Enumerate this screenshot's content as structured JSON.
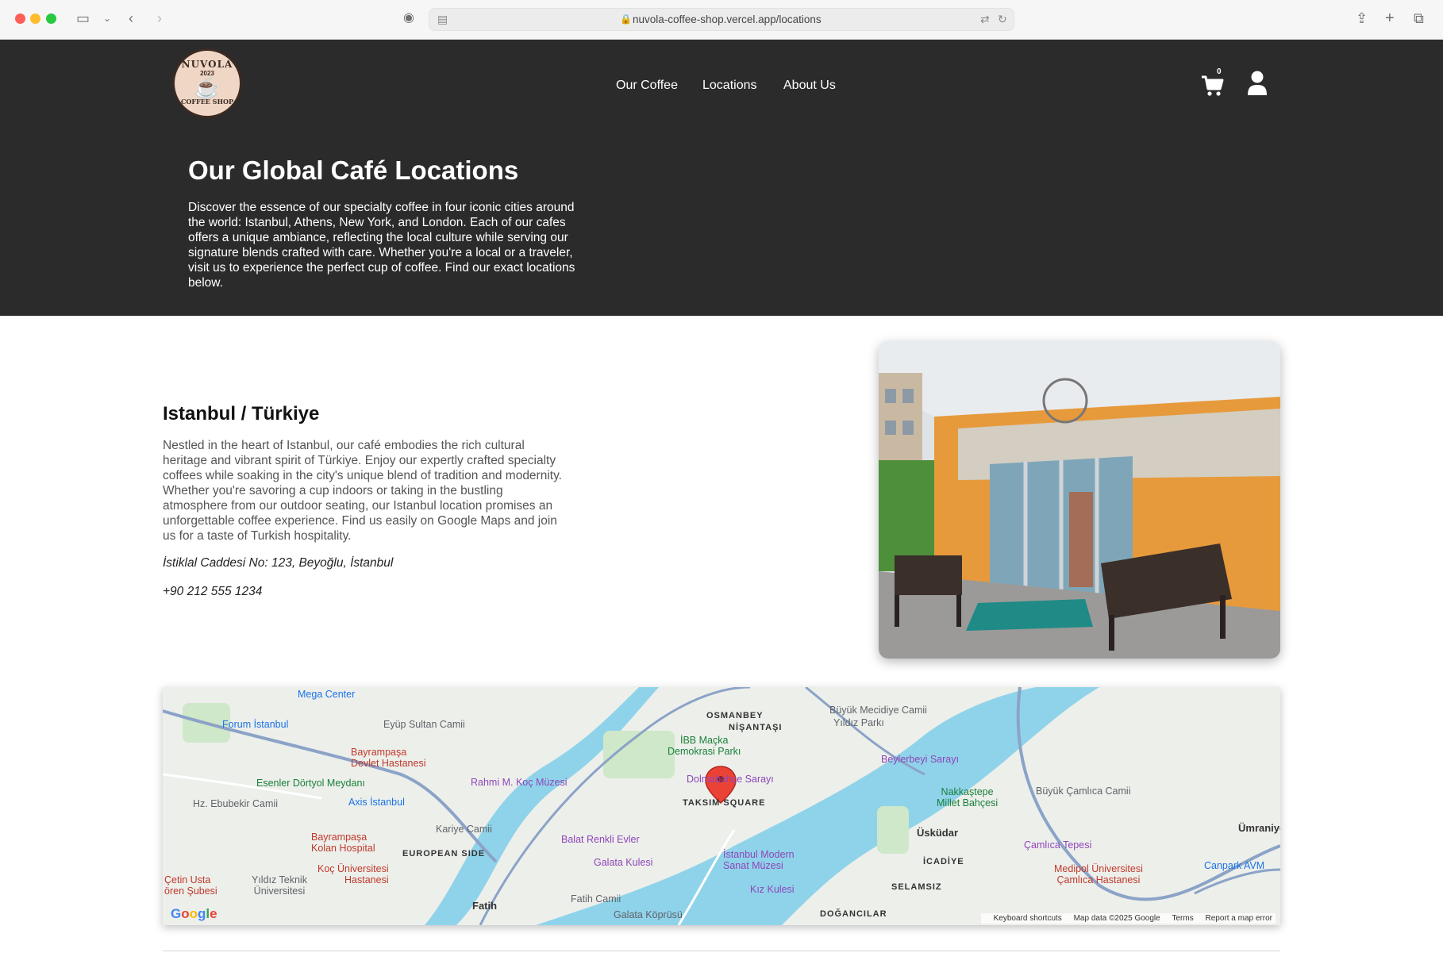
{
  "browser": {
    "url": "nuvola-coffee-shop.vercel.app/locations"
  },
  "header": {
    "logo": {
      "top": "NUVOLA",
      "year": "2023",
      "bottom": "COFFEE SHOP"
    },
    "nav": [
      "Our Coffee",
      "Locations",
      "About Us"
    ],
    "cart_count": "0",
    "icons": [
      "cart-icon",
      "user-icon"
    ]
  },
  "hero": {
    "title": "Our Global Café Locations",
    "text": "Discover the essence of our specialty coffee in four iconic cities around the world: Istanbul, Athens, New York, and London. Each of our cafes offers a unique ambiance, reflecting the local culture while serving our signature blends crafted with care. Whether you're a local or a traveler, visit us to experience the perfect cup of coffee. Find our exact locations below."
  },
  "location": {
    "title": "Istanbul / Türkiye",
    "description": "Nestled in the heart of Istanbul, our café embodies the rich cultural heritage and vibrant spirit of Türkiye. Enjoy our expertly crafted specialty coffees while soaking in the city's unique blend of tradition and modernity. Whether you're savoring a cup indoors or taking in the bustling atmosphere from our outdoor seating, our Istanbul location promises an unforgettable coffee experience. Find us easily on Google Maps and join us for a taste of Turkish hospitality.",
    "address": "İstiklal Caddesi No: 123, Beyoğlu, İstanbul",
    "phone": "+90 212 555 1234"
  },
  "map": {
    "labels": {
      "mega_center": "Mega Center",
      "forum": "Forum İstanbul",
      "eyup": "Eyüp Sultan Camii",
      "bayrampasa_devlet": "Bayrampaşa\nDevlet Hastanesi",
      "esenler": "Esenler Dörtyol Meydanı",
      "rahmi": "Rahmi M. Koç Müzesi",
      "axis": "Axis İstanbul",
      "ebubekir": "Hz. Ebubekir Camii",
      "bayrampasa_kolan": "Bayrampaşa\nKolan Hospital",
      "kariye": "Kariye Camii",
      "balat": "Balat Renkli Evler",
      "koc_uni": "Koç Üniversitesi\nHastanesi",
      "european": "EUROPEAN SIDE",
      "yildiz": "Yıldız Teknik\nÜniversitesi",
      "fatih": "Fatih",
      "fatih_camii": "Fatih Camii",
      "galata_kulesi": "Galata Kulesi",
      "galata_koprusu": "Galata Köprüsü",
      "osmanbey": "OSMANBEY",
      "nisantasi": "NİŞANTAŞI",
      "ibb": "İBB Maçka\nDemokrasi Parkı",
      "dolmabahce": "Dolmabahçe Sarayı",
      "taksim": "TAKSIM SQUARE",
      "istanbul_modern": "İstanbul Modern\nSanat Müzesi",
      "kiz_kulesi": "Kız Kulesi",
      "buyuk_mecidiye": "Büyük Mecidiye Camii",
      "yildiz_parki": "Yıldız Parkı",
      "beylerbeyi": "Beylerbeyi Sarayı",
      "nakkastepe": "Nakkaştepe\nMillet Bahçesi",
      "uskudar": "Üsküdar",
      "icadiye": "İCADİYE",
      "selamsiz": "SELAMSIZ",
      "dogancilar": "DOĞANCILAR",
      "buyuk_camlica": "Büyük Çamlıca Camii",
      "camlica_tepesi": "Çamlıca Tepesi",
      "medipol": "Medipol Üniversitesi\nÇamlıca Hastanesi",
      "canpark": "Canpark AVM",
      "umraniye": "Ümraniye",
      "cetin_usta": "Çetin Usta\nören Şubesi",
      "google": "Google"
    },
    "footer": {
      "shortcuts": "Keyboard shortcuts",
      "data": "Map data ©2025 Google",
      "terms": "Terms",
      "report": "Report a map error"
    }
  }
}
